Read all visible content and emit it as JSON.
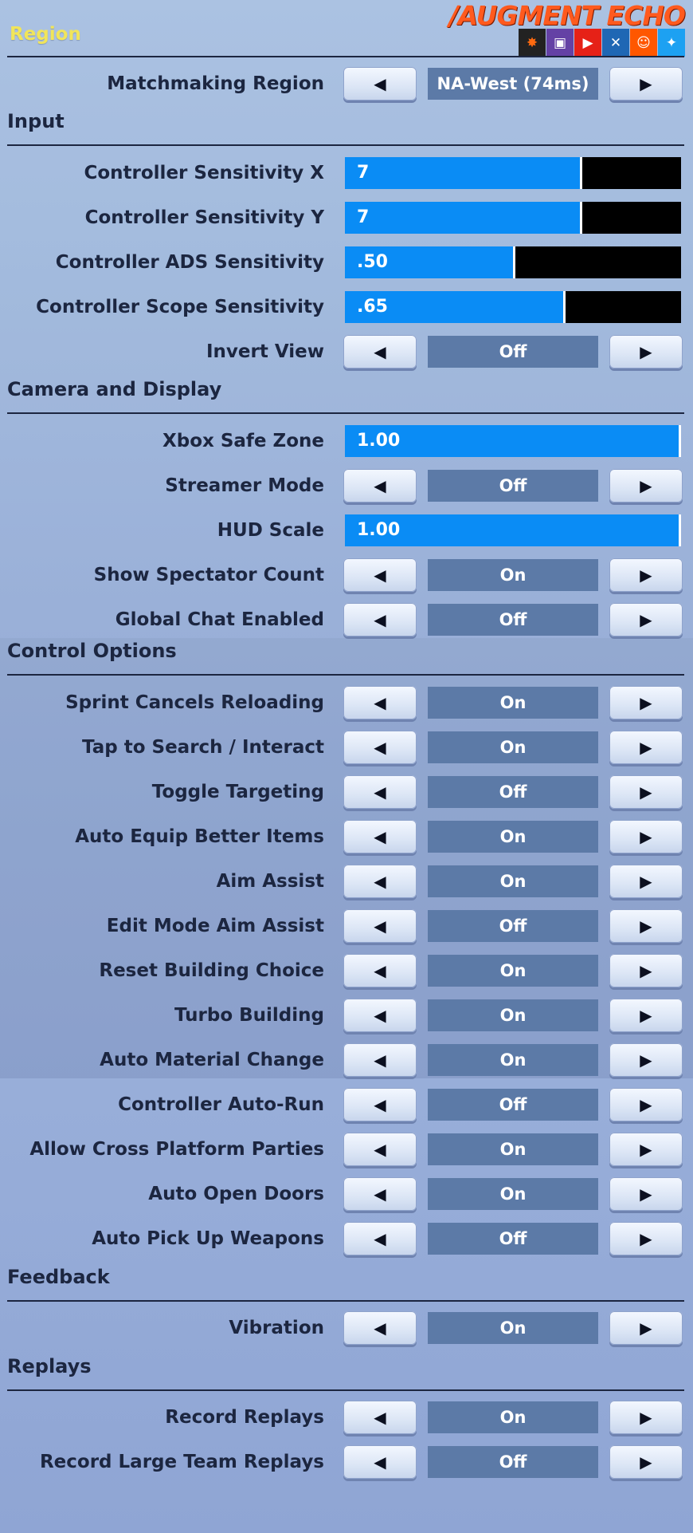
{
  "region": {
    "title": "Region",
    "rows": [
      {
        "label": "Matchmaking Region",
        "value": "NA-West (74ms)"
      }
    ]
  },
  "brand": {
    "logo": "/AUGMENT ECHO",
    "social": [
      {
        "icon": "overwatch-icon",
        "glyph": "✸",
        "color": "#222222"
      },
      {
        "icon": "twitch-icon",
        "glyph": "▣",
        "color": "#6441a5"
      },
      {
        "icon": "youtube-icon",
        "glyph": "▶",
        "color": "#e62117"
      },
      {
        "icon": "mixer-icon",
        "glyph": "✕",
        "color": "#1f67b4"
      },
      {
        "icon": "reddit-icon",
        "glyph": "☺",
        "color": "#ff5700"
      },
      {
        "icon": "twitter-icon",
        "glyph": "✦",
        "color": "#1da1f2"
      }
    ]
  },
  "input": {
    "title": "Input",
    "sliders": [
      {
        "label": "Controller Sensitivity X",
        "value": "7",
        "fraction": 0.7
      },
      {
        "label": "Controller Sensitivity Y",
        "value": "7",
        "fraction": 0.7
      },
      {
        "label": "Controller ADS Sensitivity",
        "value": ".50",
        "fraction": 0.5
      },
      {
        "label": "Controller Scope Sensitivity",
        "value": ".65",
        "fraction": 0.65
      }
    ],
    "rows": [
      {
        "label": "Invert View",
        "value": "Off"
      }
    ]
  },
  "camera": {
    "title": "Camera and Display",
    "items": [
      {
        "kind": "slider",
        "label": "Xbox Safe Zone",
        "value": "1.00",
        "fraction": 1.0
      },
      {
        "kind": "toggle",
        "label": "Streamer Mode",
        "value": "Off"
      },
      {
        "kind": "slider",
        "label": "HUD Scale",
        "value": "1.00",
        "fraction": 1.0
      },
      {
        "kind": "toggle",
        "label": "Show Spectator Count",
        "value": "On"
      },
      {
        "kind": "toggle",
        "label": "Global Chat Enabled",
        "value": "Off"
      }
    ]
  },
  "control": {
    "title": "Control Options",
    "rows": [
      {
        "label": "Sprint Cancels Reloading",
        "value": "On"
      },
      {
        "label": "Tap to Search / Interact",
        "value": "On"
      },
      {
        "label": "Toggle Targeting",
        "value": "Off"
      },
      {
        "label": "Auto Equip Better Items",
        "value": "On"
      },
      {
        "label": "Aim Assist",
        "value": "On"
      },
      {
        "label": "Edit Mode Aim Assist",
        "value": "Off"
      },
      {
        "label": "Reset Building Choice",
        "value": "On"
      },
      {
        "label": "Turbo Building",
        "value": "On"
      },
      {
        "label": "Auto Material Change",
        "value": "On"
      },
      {
        "label": "Controller Auto-Run",
        "value": "Off"
      },
      {
        "label": "Allow Cross Platform Parties",
        "value": "On"
      },
      {
        "label": "Auto Open Doors",
        "value": "On"
      },
      {
        "label": "Auto Pick Up Weapons",
        "value": "Off"
      }
    ]
  },
  "feedback": {
    "title": "Feedback",
    "rows": [
      {
        "label": "Vibration",
        "value": "On"
      }
    ]
  },
  "replays": {
    "title": "Replays",
    "rows": [
      {
        "label": "Record Replays",
        "value": "On"
      },
      {
        "label": "Record Large Team Replays",
        "value": "Off"
      }
    ]
  },
  "arrows": {
    "left": "◀",
    "right": "▶"
  },
  "colors": {
    "slider_fill": "#0a8cf5",
    "value_box": "#5c7aa7",
    "title": "#f1e55a",
    "logo": "#ff5a1e"
  }
}
